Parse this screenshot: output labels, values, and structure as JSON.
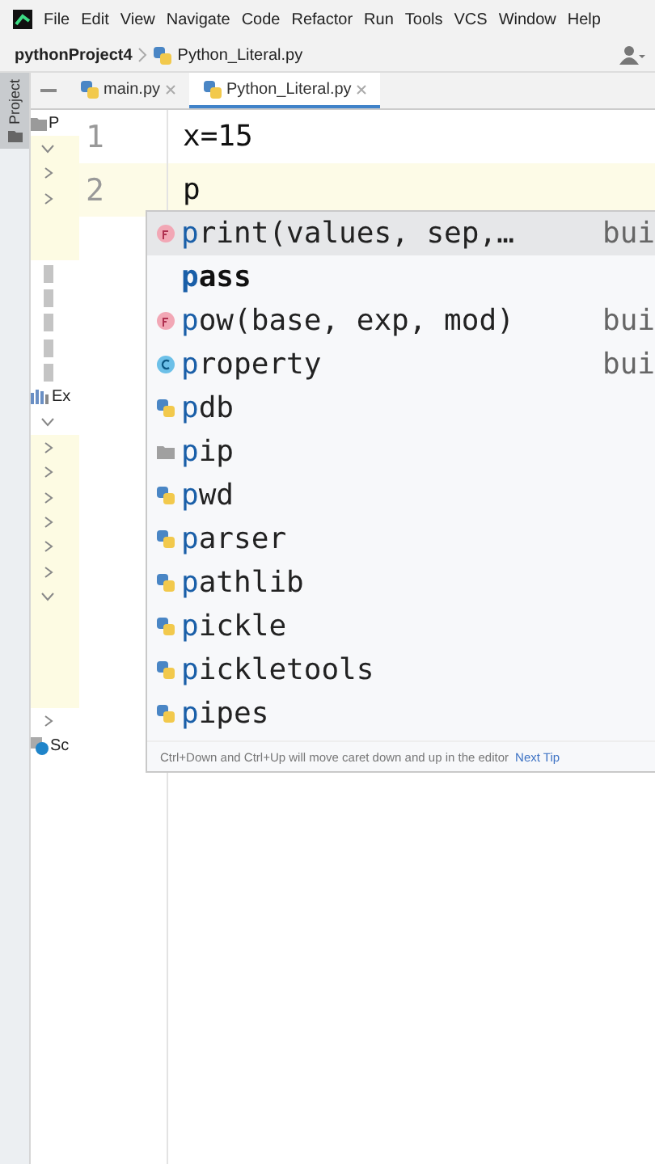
{
  "menu": [
    "File",
    "Edit",
    "View",
    "Navigate",
    "Code",
    "Refactor",
    "Run",
    "Tools",
    "VCS",
    "Window",
    "Help"
  ],
  "breadcrumb": {
    "project": "pythonProject4",
    "file": "Python_Literal.py"
  },
  "tool_stripe": {
    "label": "Project",
    "selected": true
  },
  "tabs": [
    {
      "label": "main.py",
      "selected": false
    },
    {
      "label": "Python_Literal.py",
      "selected": true
    }
  ],
  "sidebar": {
    "items": [
      {
        "kind": "folder",
        "label": "P"
      },
      {
        "kind": "chevron",
        "expanded": true,
        "highlighted": true
      },
      {
        "kind": "chevron",
        "expanded": false,
        "highlighted": true
      },
      {
        "kind": "chevron",
        "expanded": false,
        "highlighted": true
      },
      {
        "kind": "blank",
        "highlighted": true
      },
      {
        "kind": "blank",
        "highlighted": true
      },
      {
        "kind": "file",
        "highlighted": false
      },
      {
        "kind": "file",
        "highlighted": false
      },
      {
        "kind": "file",
        "highlighted": false
      },
      {
        "kind": "file",
        "highlighted": false
      },
      {
        "kind": "file",
        "highlighted": false
      },
      {
        "kind": "library",
        "label": "Ex"
      },
      {
        "kind": "chevron",
        "expanded": true,
        "highlighted": false
      },
      {
        "kind": "chevron",
        "expanded": false,
        "highlighted": true
      },
      {
        "kind": "chevron",
        "expanded": false,
        "highlighted": true
      },
      {
        "kind": "chevron",
        "expanded": false,
        "highlighted": true
      },
      {
        "kind": "chevron",
        "expanded": false,
        "highlighted": true
      },
      {
        "kind": "chevron",
        "expanded": false,
        "highlighted": true
      },
      {
        "kind": "chevron",
        "expanded": false,
        "highlighted": true
      },
      {
        "kind": "chevron",
        "expanded": true,
        "highlighted": true
      },
      {
        "kind": "blank",
        "highlighted": true
      },
      {
        "kind": "blank",
        "highlighted": true
      },
      {
        "kind": "blank",
        "highlighted": true
      },
      {
        "kind": "blank",
        "highlighted": true
      },
      {
        "kind": "chevron",
        "expanded": false,
        "highlighted": false
      },
      {
        "kind": "scratches",
        "label": "Sc"
      }
    ]
  },
  "editor": {
    "lines": [
      {
        "number": "1",
        "code": "x=15",
        "current": false
      },
      {
        "number": "2",
        "code": "p",
        "current": true
      }
    ]
  },
  "completion": {
    "items": [
      {
        "kind": "function",
        "name": "print(values, sep,…",
        "type": "bui",
        "selected": true
      },
      {
        "kind": "keyword",
        "name": "pass",
        "selected": false
      },
      {
        "kind": "function",
        "name": "pow(base, exp, mod)",
        "type": "bui",
        "selected": false
      },
      {
        "kind": "class",
        "name": "property",
        "type": "bui",
        "selected": false
      },
      {
        "kind": "module",
        "name": "pdb",
        "selected": false
      },
      {
        "kind": "package",
        "name": "pip",
        "selected": false
      },
      {
        "kind": "module",
        "name": "pwd",
        "selected": false
      },
      {
        "kind": "module",
        "name": "parser",
        "selected": false
      },
      {
        "kind": "module",
        "name": "pathlib",
        "selected": false
      },
      {
        "kind": "module",
        "name": "pickle",
        "selected": false
      },
      {
        "kind": "module",
        "name": "pickletools",
        "selected": false
      },
      {
        "kind": "module",
        "name": "pipes",
        "selected": false
      }
    ],
    "tip": "Ctrl+Down and Ctrl+Up will move caret down and up in the editor",
    "tip_link": "Next Tip"
  }
}
